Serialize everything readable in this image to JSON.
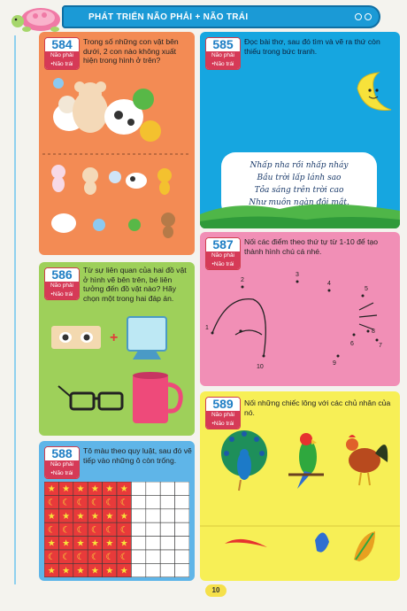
{
  "header": {
    "title": "PHÁT TRIỂN NÃO PHẢI + NÃO TRÁI"
  },
  "badge_tag": {
    "line1": "Não phải",
    "line2": "•Não trái"
  },
  "exercises": [
    {
      "number": "584",
      "text": "Trong số những con vật bên dưới, 2 con nào không xuất hiện trong hình ở trên?"
    },
    {
      "number": "585",
      "text": "Đọc bài thơ, sau đó tìm và vẽ ra thứ còn thiếu trong bức tranh.",
      "poem": [
        "Nhấp nha rồi nhấp nháy",
        "Bầu trời lấp lánh sao",
        "Tỏa sáng trên trời cao",
        "Như muôn ngàn đôi mắt."
      ]
    },
    {
      "number": "586",
      "text": "Từ sự liên quan của hai đồ vật ở hình vẽ bên trên, bé liên tưởng đến đồ vật nào? Hãy chọn một trong hai đáp án."
    },
    {
      "number": "587",
      "text": "Nối các điểm theo thứ tự từ 1-10 để tạo thành hình chú cá nhé.",
      "dot_labels": [
        "1",
        "2",
        "3",
        "4",
        "5",
        "6",
        "7",
        "8",
        "9",
        "10"
      ]
    },
    {
      "number": "588",
      "text": "Tô màu theo quy luật, sau đó vẽ tiếp vào những ô còn trống."
    },
    {
      "number": "589",
      "text": "Nối những chiếc lông với các chủ nhân của nó."
    }
  ],
  "page_number": "10",
  "colors": {
    "header_blue": "#1b9ad6",
    "orange": "#f38b54",
    "sky": "#16a6e0",
    "green": "#9ed05a",
    "pink": "#f18fb6",
    "blue": "#5fb5e8",
    "yellow": "#f7ef56"
  },
  "icons": [
    "turtle-icon",
    "moon-icon",
    "mirror-icon",
    "glasses-icon",
    "mug-icon",
    "peacock-icon",
    "parrot-icon",
    "rooster-icon",
    "feather-icon"
  ]
}
